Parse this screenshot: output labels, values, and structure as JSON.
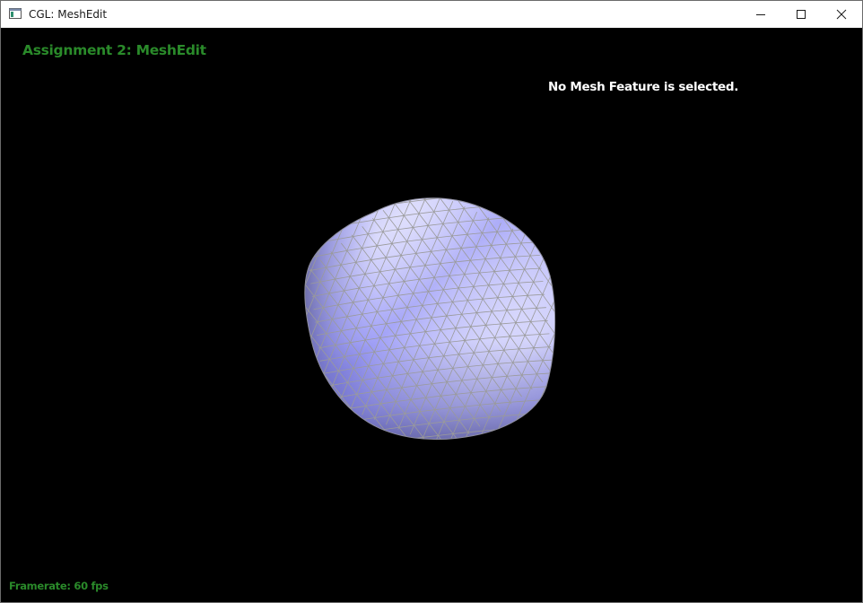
{
  "window": {
    "title": "CGL: MeshEdit",
    "icon": "app-window-icon",
    "controls": {
      "minimize_icon": "minimize-icon",
      "maximize_icon": "maximize-icon",
      "close_icon": "close-icon"
    }
  },
  "viewport": {
    "background": "#000000",
    "app_title": "Assignment 2: MeshEdit",
    "selection_status": "No Mesh Feature is selected.",
    "framerate": "Framerate: 60 fps",
    "mesh": {
      "shape": "subdivided triangle-mesh sphere (cube-like blob)",
      "fill_light": "#f4f4ff",
      "fill_mid": "#c9c9fb",
      "fill_dark": "#8a8aef",
      "wire_color": "#9a9a9a"
    }
  },
  "colors": {
    "accent_green": "#2a8a2a",
    "status_text": "#ffffff"
  }
}
